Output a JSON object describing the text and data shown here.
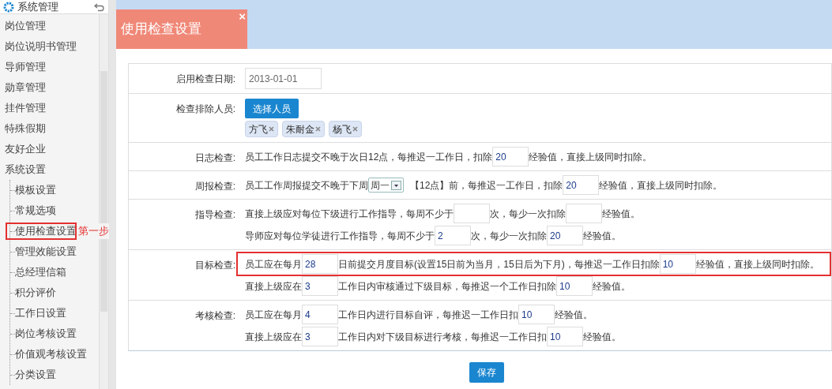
{
  "sidebar": {
    "title": "系统管理",
    "items": [
      {
        "label": "岗位管理"
      },
      {
        "label": "岗位说明书管理"
      },
      {
        "label": "导师管理"
      },
      {
        "label": "勋章管理"
      },
      {
        "label": "挂件管理"
      },
      {
        "label": "特殊假期"
      },
      {
        "label": "友好企业"
      },
      {
        "label": "系统设置",
        "children": [
          {
            "label": "模板设置"
          },
          {
            "label": "常规选项"
          },
          {
            "label": "使用检查设置",
            "callout": "第一步"
          },
          {
            "label": "管理效能设置"
          },
          {
            "label": "总经理信箱"
          },
          {
            "label": "积分评价"
          },
          {
            "label": "工作日设置"
          },
          {
            "label": "岗位考核设置"
          },
          {
            "label": "价值观考核设置"
          },
          {
            "label": "分类设置"
          }
        ]
      }
    ]
  },
  "tab": {
    "title": "使用检查设置",
    "close": "×"
  },
  "form": {
    "rows": [
      {
        "label": "启用检查日期:",
        "kind": "date",
        "value": "2013-01-01"
      },
      {
        "label": "检查排除人员:",
        "kind": "people",
        "button": "选择人员",
        "people": [
          {
            "name": "方飞"
          },
          {
            "name": "朱耐金"
          },
          {
            "name": "杨飞"
          }
        ]
      },
      {
        "label": "日志检查:",
        "kind": "lines",
        "lines": [
          {
            "highlighted": false,
            "parts": [
              {
                "kind": "text",
                "text": "员工工作日志提交不晚于次日12点，每推迟一工作日，扣除"
              },
              {
                "kind": "input",
                "value": "20"
              },
              {
                "kind": "text",
                "text": "经验值，直接上级同时扣除。"
              }
            ]
          }
        ]
      },
      {
        "label": "周报检查:",
        "kind": "lines",
        "lines": [
          {
            "highlighted": false,
            "parts": [
              {
                "kind": "text",
                "text": "员工工作周报提交不晚于下周"
              },
              {
                "kind": "select",
                "value": "周一"
              },
              {
                "kind": "text",
                "text": "【12点】前，每推迟一工作日，扣除"
              },
              {
                "kind": "input",
                "value": "20"
              },
              {
                "kind": "text",
                "text": "经验值，直接上级同时扣除。"
              }
            ]
          }
        ]
      },
      {
        "label": "指导检查:",
        "kind": "lines",
        "lines": [
          {
            "highlighted": false,
            "parts": [
              {
                "kind": "text",
                "text": "直接上级应对每位下级进行工作指导，每周不少于"
              },
              {
                "kind": "input"
              },
              {
                "kind": "text",
                "text": "次，每少一次扣除"
              },
              {
                "kind": "input"
              },
              {
                "kind": "text",
                "text": "经验值。"
              }
            ]
          },
          {
            "highlighted": false,
            "parts": [
              {
                "kind": "text",
                "text": "导师应对每位学徒进行工作指导，每周不少于"
              },
              {
                "kind": "input",
                "value": "2"
              },
              {
                "kind": "text",
                "text": "次，每少一次扣除"
              },
              {
                "kind": "input",
                "value": "20"
              },
              {
                "kind": "text",
                "text": "经验值。"
              }
            ]
          }
        ]
      },
      {
        "label": "目标检查:",
        "kind": "lines",
        "lines": [
          {
            "highlighted": true,
            "parts": [
              {
                "kind": "text",
                "text": "员工应在每月"
              },
              {
                "kind": "input",
                "value": "28"
              },
              {
                "kind": "text",
                "text": "日前提交月度目标(设置15日前为当月，15日后为下月)，每推迟一工作日扣除"
              },
              {
                "kind": "input",
                "value": "10"
              },
              {
                "kind": "text",
                "text": "经验值，直接上级同时扣除。"
              }
            ]
          },
          {
            "highlighted": false,
            "parts": [
              {
                "kind": "text",
                "text": "直接上级应在"
              },
              {
                "kind": "input",
                "value": "3"
              },
              {
                "kind": "text",
                "text": "工作日内审核通过下级目标，每推迟一个工作日扣除"
              },
              {
                "kind": "input",
                "value": "10"
              },
              {
                "kind": "text",
                "text": "经验值。"
              }
            ]
          }
        ]
      },
      {
        "label": "考核检查:",
        "kind": "lines",
        "lines": [
          {
            "highlighted": false,
            "parts": [
              {
                "kind": "text",
                "text": "员工应在每月"
              },
              {
                "kind": "input",
                "value": "4"
              },
              {
                "kind": "text",
                "text": "工作日内进行目标自评，每推迟一工作日扣"
              },
              {
                "kind": "input",
                "value": "10"
              },
              {
                "kind": "text",
                "text": "经验值。"
              }
            ]
          },
          {
            "highlighted": false,
            "parts": [
              {
                "kind": "text",
                "text": "直接上级应在"
              },
              {
                "kind": "input",
                "value": "3"
              },
              {
                "kind": "text",
                "text": "工作日内对下级目标进行考核，每推迟一工作日扣"
              },
              {
                "kind": "input",
                "value": "10"
              },
              {
                "kind": "text",
                "text": "经验值。"
              }
            ]
          }
        ]
      }
    ],
    "save": "保存"
  }
}
